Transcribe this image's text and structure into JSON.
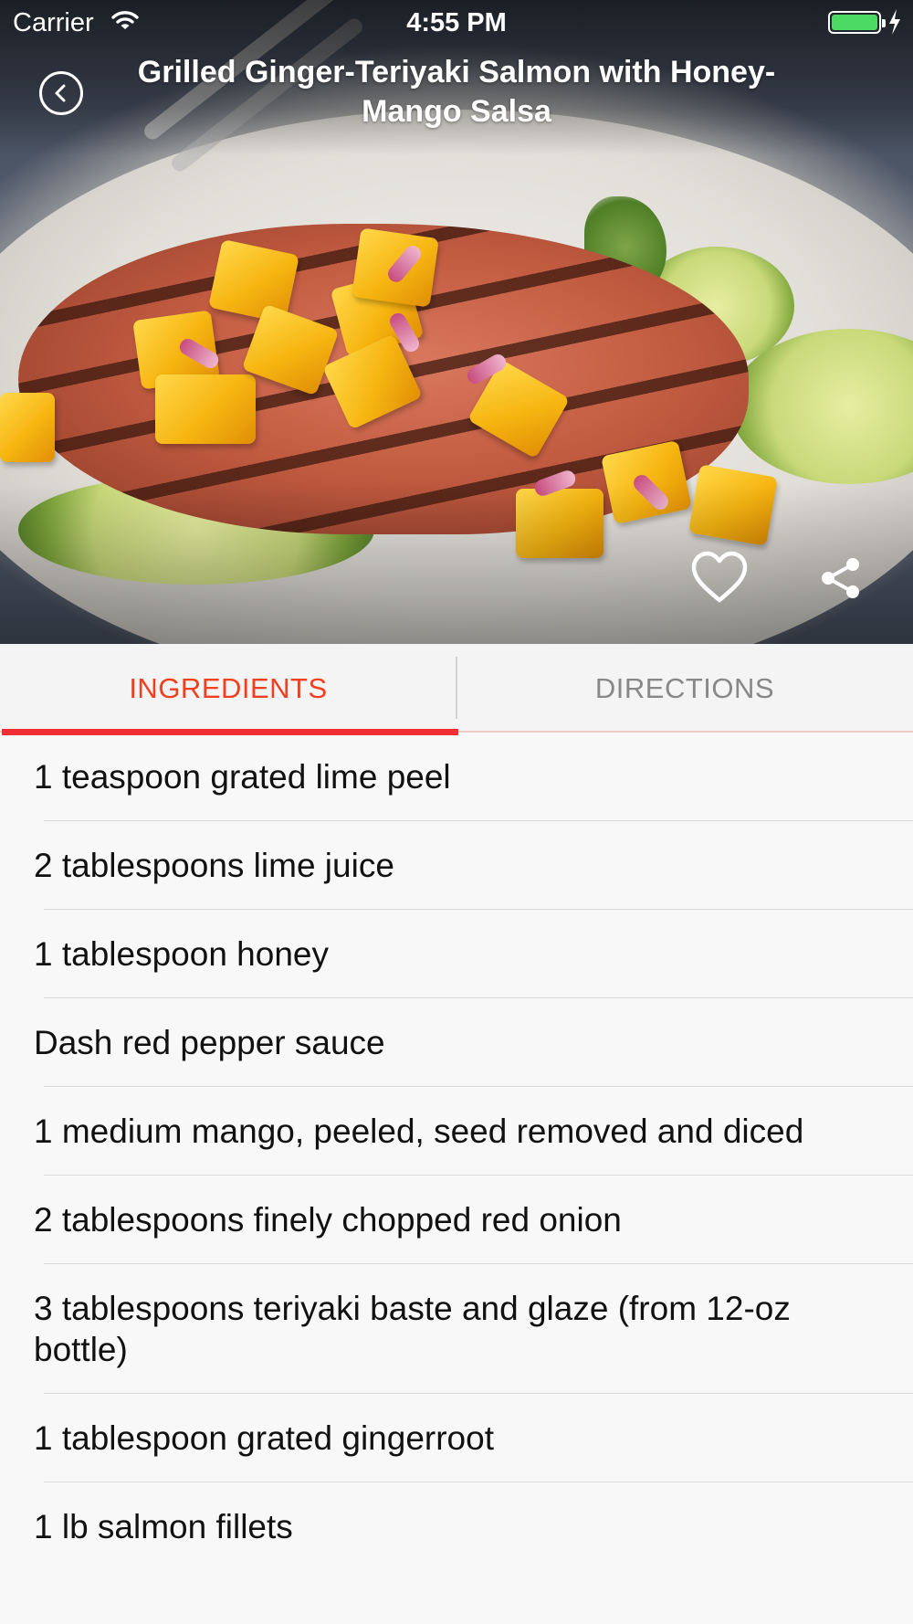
{
  "status_bar": {
    "carrier": "Carrier",
    "time": "4:55 PM",
    "battery_color": "#4cd964"
  },
  "nav": {
    "title": "Grilled Ginger-Teriyaki Salmon with Honey-Mango Salsa",
    "back_icon": "chevron-left-circle-icon",
    "favorite_icon": "heart-outline-icon",
    "share_icon": "share-icon"
  },
  "tabs": [
    {
      "label": "INGREDIENTS",
      "active": true,
      "color": "#f0401f"
    },
    {
      "label": "DIRECTIONS",
      "active": false,
      "color": "#888888"
    }
  ],
  "accent_color": "#f22e35",
  "ingredients": [
    "1 teaspoon grated lime peel",
    "2 tablespoons lime juice",
    "1 tablespoon honey",
    "Dash red pepper sauce",
    "1 medium mango, peeled, seed removed and diced",
    "2 tablespoons finely chopped red onion",
    "3 tablespoons teriyaki baste and glaze (from 12-oz bottle)",
    "1 tablespoon grated gingerroot",
    "1 lb salmon fillets"
  ]
}
